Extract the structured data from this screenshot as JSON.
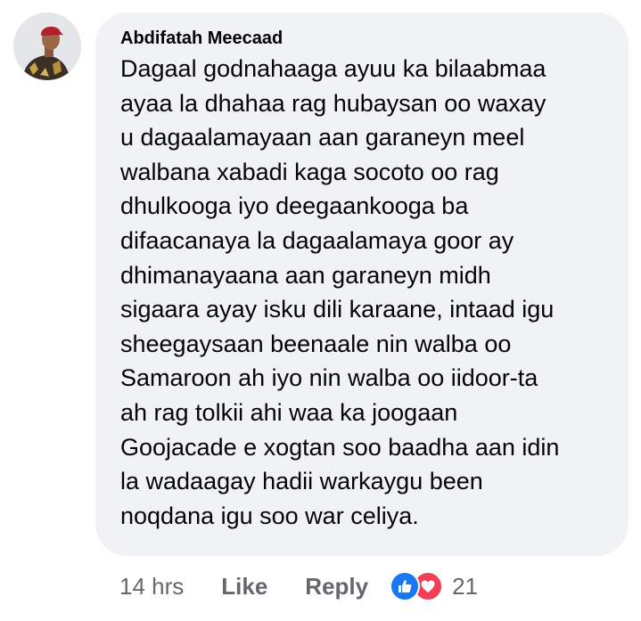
{
  "comment": {
    "author": "Abdifatah Meecaad",
    "text_lines": [
      "Dagaal godnahaaga ayuu ka bilaabmaa",
      "ayaa la dhahaa rag hubaysan oo waxay",
      "u dagaalamayaan aan garaneyn meel",
      "walbana xabadi kaga socoto oo rag",
      "dhulkooga iyo deegaankooga ba",
      "difaacanaya la dagaalamaya goor ay",
      "dhimanayaana aan garaneyn midh",
      "sigaara ayay isku dili karaane, intaad igu",
      "sheegaysaan beenaale nin walba oo",
      "Samaroon ah iyo nin walba oo iidoor-ta",
      "ah rag tolkii ahi waa ka joogaan",
      "Goojacade e xogtan soo baadha aan idin",
      "la wadaagay hadii warkaygu been",
      "noqdana igu soo war celiya."
    ]
  },
  "actions": {
    "time": "14 hrs",
    "like_label": "Like",
    "reply_label": "Reply",
    "reaction_count": "21",
    "reactions": [
      "like-icon",
      "love-icon"
    ]
  },
  "colors": {
    "bubble_bg": "#f0f2f5",
    "text": "#050505",
    "meta_text": "#65676b",
    "like_blue": "#1877f2",
    "love_red": "#f33e58"
  }
}
